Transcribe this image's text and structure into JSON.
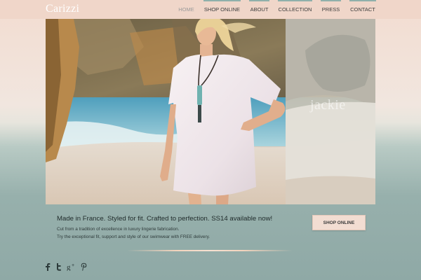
{
  "brand": {
    "name": "Carizzi"
  },
  "nav": {
    "items": [
      {
        "label": "HOME",
        "active": true
      },
      {
        "label": "SHOP ONLINE",
        "active": false
      },
      {
        "label": "ABOUT",
        "active": false
      },
      {
        "label": "COLLECTION",
        "active": false
      },
      {
        "label": "PRESS",
        "active": false
      },
      {
        "label": "CONTACT",
        "active": false
      }
    ],
    "accent_color": "#8fb0ab"
  },
  "hero": {
    "watermark": "jackie"
  },
  "content": {
    "headline": "Made in France. Styled for fit. Crafted to perfection. SS14 available now!",
    "line1": "Cut from a tradition of excellence in luxury lingerie fabrication.",
    "line2": "Try the exceptional fit, support and style of our swimwear with FREE delivery."
  },
  "cta": {
    "label": "SHOP ONLINE"
  },
  "social": {
    "icons": [
      "facebook-icon",
      "twitter-icon",
      "google-plus-icon",
      "pinterest-icon"
    ]
  },
  "colors": {
    "topbar": "#f0d6c9",
    "button": "#f2ddd2",
    "background_bottom": "#8fa9a6"
  }
}
